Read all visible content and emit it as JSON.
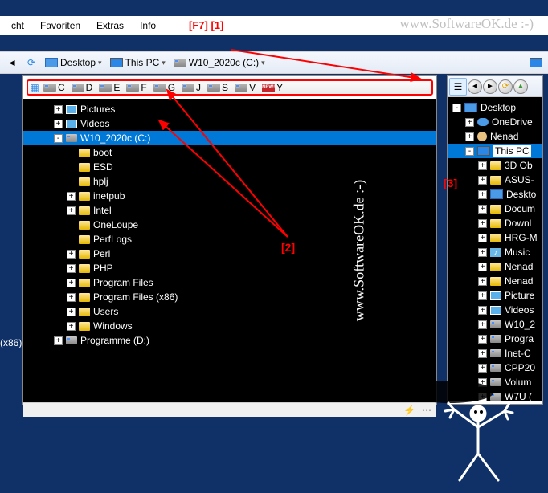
{
  "menu": {
    "items": [
      "cht",
      "Favoriten",
      "Extras",
      "Info"
    ]
  },
  "annotations": {
    "top": "[F7] [1]",
    "two": "[2]",
    "three": "[3]"
  },
  "watermark": "www.SoftwareOK.de :-)",
  "breadcrumbs": [
    {
      "label": "Desktop",
      "icon": "desktop"
    },
    {
      "label": "This PC",
      "icon": "monitor"
    },
    {
      "label": "W10_2020c (C:)",
      "icon": "disk"
    }
  ],
  "drives": [
    "C",
    "D",
    "E",
    "F",
    "G",
    "J",
    "S",
    "V",
    "Y"
  ],
  "tree": [
    {
      "depth": 2,
      "exp": "+",
      "icon": "pic",
      "label": "Pictures"
    },
    {
      "depth": 2,
      "exp": "+",
      "icon": "pic",
      "label": "Videos"
    },
    {
      "depth": 2,
      "exp": "-",
      "icon": "disk",
      "label": "W10_2020c (C:)",
      "sel": true
    },
    {
      "depth": 3,
      "exp": "",
      "icon": "folder",
      "label": "boot"
    },
    {
      "depth": 3,
      "exp": "",
      "icon": "folder",
      "label": "ESD"
    },
    {
      "depth": 3,
      "exp": "",
      "icon": "folder",
      "label": "hplj"
    },
    {
      "depth": 3,
      "exp": "+",
      "icon": "folder",
      "label": "inetpub"
    },
    {
      "depth": 3,
      "exp": "+",
      "icon": "folder",
      "label": "Intel"
    },
    {
      "depth": 3,
      "exp": "",
      "icon": "folder",
      "label": "OneLoupe"
    },
    {
      "depth": 3,
      "exp": "",
      "icon": "folder",
      "label": "PerfLogs"
    },
    {
      "depth": 3,
      "exp": "+",
      "icon": "folder",
      "label": "Perl"
    },
    {
      "depth": 3,
      "exp": "+",
      "icon": "folder",
      "label": "PHP"
    },
    {
      "depth": 3,
      "exp": "+",
      "icon": "folder",
      "label": "Program Files"
    },
    {
      "depth": 3,
      "exp": "+",
      "icon": "folder",
      "label": "Program Files (x86)"
    },
    {
      "depth": 3,
      "exp": "+",
      "icon": "folder",
      "label": "Users"
    },
    {
      "depth": 3,
      "exp": "+",
      "icon": "folder",
      "label": "Windows"
    },
    {
      "depth": 2,
      "exp": "+",
      "icon": "disk",
      "label": "Programme (D:)"
    }
  ],
  "rightTree": [
    {
      "depth": 0,
      "exp": "-",
      "icon": "desktop",
      "label": "Desktop"
    },
    {
      "depth": 1,
      "exp": "+",
      "icon": "cloud",
      "label": "OneDrive"
    },
    {
      "depth": 1,
      "exp": "+",
      "icon": "user",
      "label": "Nenad"
    },
    {
      "depth": 1,
      "exp": "-",
      "icon": "monitor",
      "label": "This PC",
      "sel": true
    },
    {
      "depth": 2,
      "exp": "+",
      "icon": "folder",
      "label": "3D Ob"
    },
    {
      "depth": 2,
      "exp": "+",
      "icon": "folder",
      "label": "ASUS-"
    },
    {
      "depth": 2,
      "exp": "+",
      "icon": "desktop",
      "label": "Deskto"
    },
    {
      "depth": 2,
      "exp": "+",
      "icon": "folder",
      "label": "Docum"
    },
    {
      "depth": 2,
      "exp": "+",
      "icon": "folder",
      "label": "Downl"
    },
    {
      "depth": 2,
      "exp": "+",
      "icon": "folder",
      "label": "HRG-M"
    },
    {
      "depth": 2,
      "exp": "+",
      "icon": "music",
      "label": "Music"
    },
    {
      "depth": 2,
      "exp": "+",
      "icon": "folder",
      "label": "Nenad"
    },
    {
      "depth": 2,
      "exp": "+",
      "icon": "folder",
      "label": "Nenad"
    },
    {
      "depth": 2,
      "exp": "+",
      "icon": "pic",
      "label": "Picture"
    },
    {
      "depth": 2,
      "exp": "+",
      "icon": "pic",
      "label": "Videos"
    },
    {
      "depth": 2,
      "exp": "+",
      "icon": "disk",
      "label": "W10_2"
    },
    {
      "depth": 2,
      "exp": "+",
      "icon": "disk",
      "label": "Progra"
    },
    {
      "depth": 2,
      "exp": "+",
      "icon": "disk",
      "label": "Inet-C"
    },
    {
      "depth": 2,
      "exp": "+",
      "icon": "disk",
      "label": "CPP20"
    },
    {
      "depth": 2,
      "exp": "+",
      "icon": "disk",
      "label": "Volum"
    },
    {
      "depth": 2,
      "exp": "+",
      "icon": "disk",
      "label": "W7U ("
    }
  ],
  "sideLabel": "(x86)"
}
